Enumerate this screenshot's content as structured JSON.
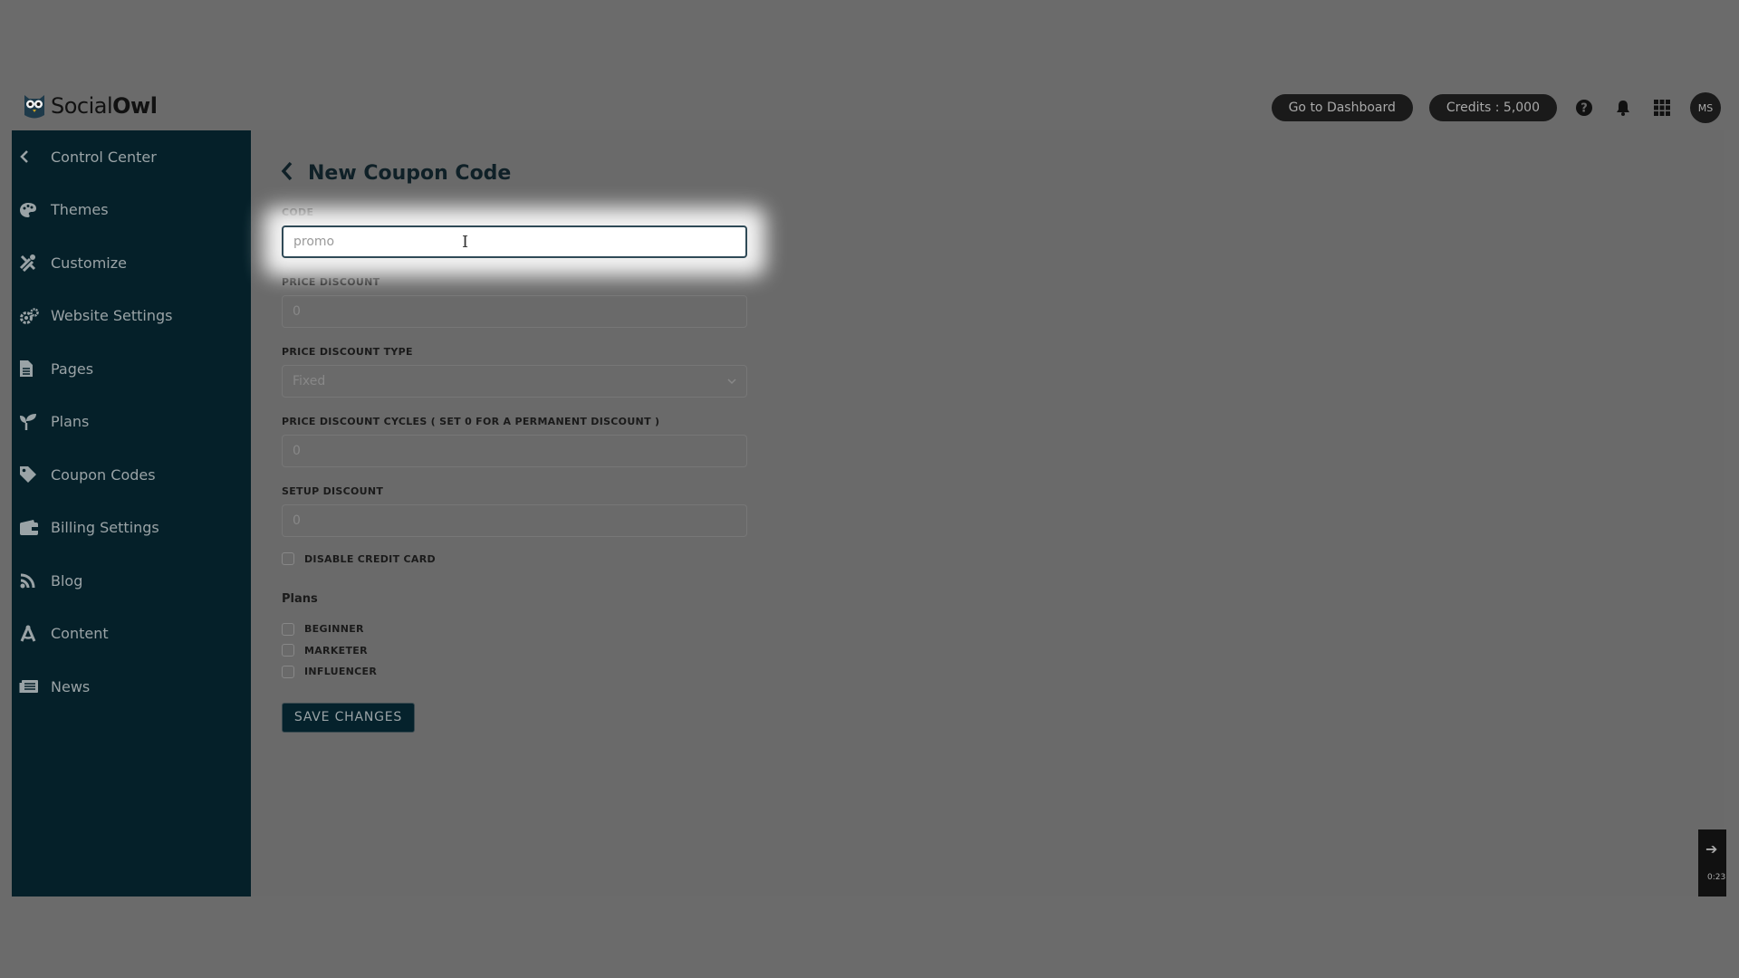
{
  "app": {
    "logo_text_light": "Social",
    "logo_text_bold": "Owl",
    "logo_icon": "owl-icon"
  },
  "header": {
    "dashboard_button": "Go to Dashboard",
    "credits_button": "Credits : 5,000",
    "help_icon": "help-icon",
    "bell_icon": "bell-icon",
    "apps_icon": "grid-icon",
    "avatar_initials": "MS"
  },
  "sidebar": {
    "items": [
      {
        "label": "Control Center",
        "icon": "chevron-left-icon"
      },
      {
        "label": "Themes",
        "icon": "palette-icon"
      },
      {
        "label": "Customize",
        "icon": "tools-icon"
      },
      {
        "label": "Website Settings",
        "icon": "cogs-icon"
      },
      {
        "label": "Pages",
        "icon": "file-icon"
      },
      {
        "label": "Plans",
        "icon": "seedling-icon"
      },
      {
        "label": "Coupon Codes",
        "icon": "tag-icon"
      },
      {
        "label": "Billing Settings",
        "icon": "wallet-icon"
      },
      {
        "label": "Blog",
        "icon": "blog-icon"
      },
      {
        "label": "Content",
        "icon": "drafting-icon"
      },
      {
        "label": "News",
        "icon": "newspaper-icon"
      }
    ]
  },
  "main": {
    "title": "New Coupon Code",
    "form": {
      "code_label": "CODE",
      "code_placeholder": "promo",
      "price_discount_label": "PRICE DISCOUNT",
      "price_discount_placeholder": "0",
      "price_discount_type_label": "PRICE DISCOUNT TYPE",
      "price_discount_type_value": "Fixed",
      "cycles_label": "PRICE DISCOUNT CYCLES ( SET 0 FOR A PERMANENT DISCOUNT )",
      "cycles_placeholder": "0",
      "setup_discount_label": "SETUP DISCOUNT",
      "setup_discount_placeholder": "0",
      "disable_cc_label": "DISABLE CREDIT CARD",
      "plans_title": "Plans",
      "plans": [
        "BEGINNER",
        "MARKETER",
        "INFLUENCER"
      ],
      "save_label": "SAVE CHANGES"
    }
  },
  "widget": {
    "time": "0:23"
  }
}
